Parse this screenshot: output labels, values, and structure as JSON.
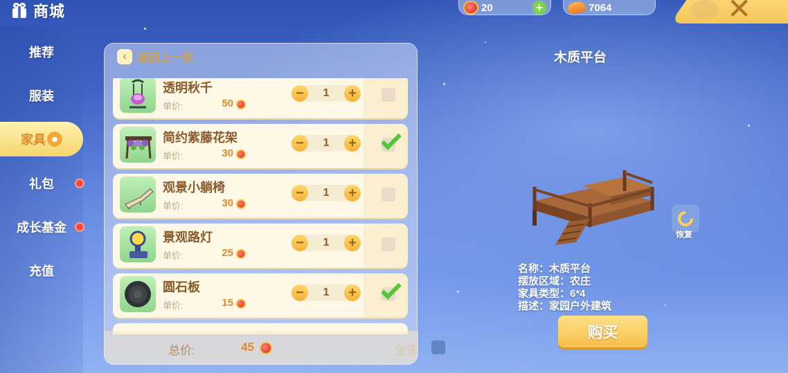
{
  "header": {
    "title": "商城",
    "gem_count": "20",
    "coin_count": "7064"
  },
  "sidebar": {
    "items": [
      {
        "label": "推荐",
        "active": false,
        "dot": false
      },
      {
        "label": "服装",
        "active": false,
        "dot": false
      },
      {
        "label": "家具",
        "active": true,
        "dot": false
      },
      {
        "label": "礼包",
        "active": false,
        "dot": true
      },
      {
        "label": "成长基金",
        "active": false,
        "dot": true
      },
      {
        "label": "充值",
        "active": false,
        "dot": false
      }
    ]
  },
  "list": {
    "back_label": "返回上一页",
    "unit_price_label": "单价:",
    "items": [
      {
        "name": "透明秋千",
        "price": "50",
        "qty": "1",
        "checked": false
      },
      {
        "name": "简约紫藤花架",
        "price": "30",
        "qty": "1",
        "checked": true
      },
      {
        "name": "观景小躺椅",
        "price": "30",
        "qty": "1",
        "checked": false
      },
      {
        "name": "景观路灯",
        "price": "25",
        "qty": "1",
        "checked": false
      },
      {
        "name": "圆石板",
        "price": "15",
        "qty": "1",
        "checked": true
      }
    ],
    "total_label": "总价:",
    "total_value": "45",
    "select_all_label": "全选"
  },
  "preview": {
    "title": "木质平台",
    "restore_label": "恢复",
    "info": [
      "名称：木质平台",
      "摆放区域：农庄",
      "家具类型：6*4",
      "描述：家园户外建筑"
    ],
    "buy_label": "购买"
  },
  "colors": {
    "accent": "#f6c04a",
    "price": "#e08a2a",
    "check": "#56c53a"
  }
}
